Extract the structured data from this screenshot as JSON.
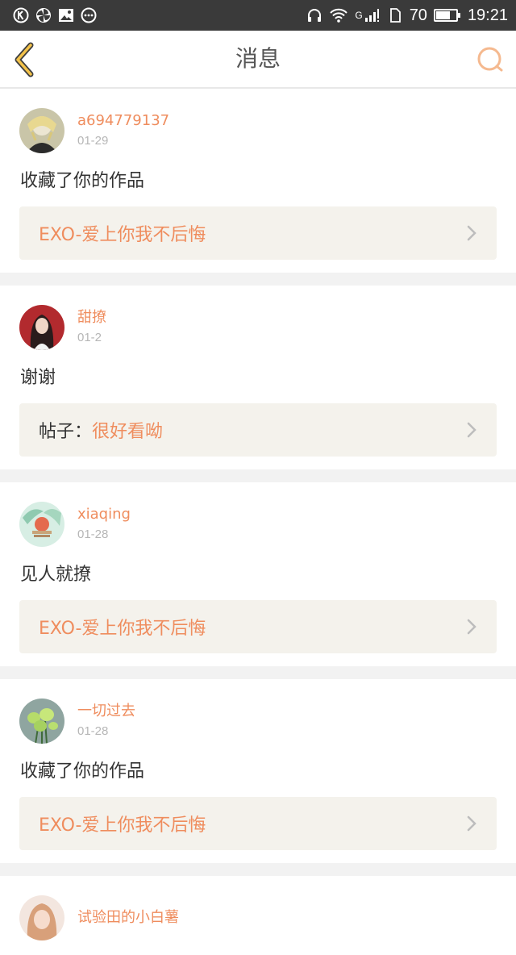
{
  "status_bar": {
    "left_icons": [
      "k-circle-icon",
      "pinwheel-icon",
      "image-icon",
      "more-dots-icon"
    ],
    "network": "G",
    "battery": "70",
    "battery_level": 0.7,
    "time": "19:21"
  },
  "header": {
    "title": "消息",
    "back_icon": "chevron-left-icon",
    "search_icon": "search-icon"
  },
  "colors": {
    "accent": "#ef8d5e",
    "back_icon": "#f3c24a",
    "ref_bg": "#f4f2ec"
  },
  "messages": [
    {
      "username": "a694779137",
      "date": "01-29",
      "text": "收藏了你的作品",
      "ref_prefix": "",
      "ref_text": "EXO-爱上你我不后悔",
      "avatar_icon": "avatar-anime"
    },
    {
      "username": "甜撩",
      "date": "01-2",
      "text": "谢谢",
      "ref_prefix": "帖子：",
      "ref_text": "很好看呦",
      "avatar_icon": "avatar-girl"
    },
    {
      "username": "xiaqing",
      "date": "01-28",
      "text": "见人就撩",
      "ref_prefix": "",
      "ref_text": "EXO-爱上你我不后悔",
      "avatar_icon": "avatar-illustration"
    },
    {
      "username": "一切过去",
      "date": "01-28",
      "text": "收藏了你的作品",
      "ref_prefix": "",
      "ref_text": "EXO-爱上你我不后悔",
      "avatar_icon": "avatar-flowers"
    },
    {
      "username": "试验田的小白薯",
      "date": "",
      "text": "",
      "ref_prefix": "",
      "ref_text": "",
      "avatar_icon": "avatar-portrait"
    }
  ]
}
